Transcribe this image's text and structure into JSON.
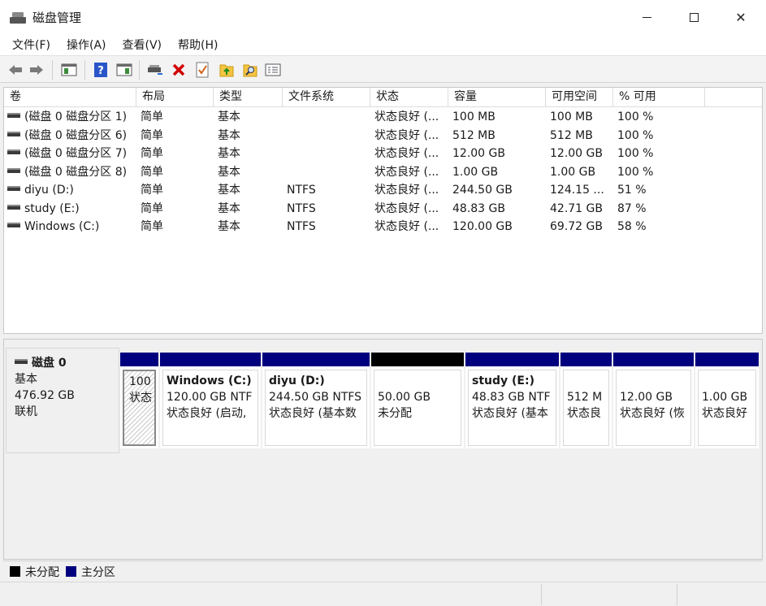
{
  "window": {
    "title": "磁盘管理"
  },
  "menu": [
    "文件(F)",
    "操作(A)",
    "查看(V)",
    "帮助(H)"
  ],
  "toolbar": {
    "icons": [
      "back-icon",
      "forward-icon",
      "properties-pane-icon",
      "help-icon",
      "action-pane-icon",
      "connect-drive-icon",
      "delete-icon",
      "check-icon",
      "import-up-icon",
      "search-icon",
      "list-icon"
    ]
  },
  "volumes": {
    "columns": [
      "卷",
      "布局",
      "类型",
      "文件系统",
      "状态",
      "容量",
      "可用空间",
      "% 可用"
    ],
    "rows": [
      [
        "(磁盘 0 磁盘分区 1)",
        "简单",
        "基本",
        "",
        "状态良好 (...",
        "100 MB",
        "100 MB",
        "100 %"
      ],
      [
        "(磁盘 0 磁盘分区 6)",
        "简单",
        "基本",
        "",
        "状态良好 (...",
        "512 MB",
        "512 MB",
        "100 %"
      ],
      [
        "(磁盘 0 磁盘分区 7)",
        "简单",
        "基本",
        "",
        "状态良好 (...",
        "12.00 GB",
        "12.00 GB",
        "100 %"
      ],
      [
        "(磁盘 0 磁盘分区 8)",
        "简单",
        "基本",
        "",
        "状态良好 (...",
        "1.00 GB",
        "1.00 GB",
        "100 %"
      ],
      [
        "diyu (D:)",
        "简单",
        "基本",
        "NTFS",
        "状态良好 (...",
        "244.50 GB",
        "124.15 ...",
        "51 %"
      ],
      [
        "study (E:)",
        "简单",
        "基本",
        "NTFS",
        "状态良好 (...",
        "48.83 GB",
        "42.71 GB",
        "87 %"
      ],
      [
        "Windows (C:)",
        "简单",
        "基本",
        "NTFS",
        "状态良好 (...",
        "120.00 GB",
        "69.72 GB",
        "58 %"
      ]
    ]
  },
  "disk": {
    "name": "磁盘 0",
    "type": "基本",
    "size": "476.92 GB",
    "status": "联机",
    "partitions": [
      {
        "title": "",
        "line1": "100",
        "line2": "状态",
        "kind": "primary"
      },
      {
        "title": "Windows  (C:)",
        "line1": "120.00 GB NTF",
        "line2": "状态良好 (启动,",
        "kind": "primary"
      },
      {
        "title": "diyu  (D:)",
        "line1": "244.50 GB NTFS",
        "line2": "状态良好 (基本数",
        "kind": "primary"
      },
      {
        "title": "",
        "line1": "50.00 GB",
        "line2": "未分配",
        "kind": "unallocated"
      },
      {
        "title": "study  (E:)",
        "line1": "48.83 GB NTF",
        "line2": "状态良好 (基本",
        "kind": "primary"
      },
      {
        "title": "",
        "line1": "512 M",
        "line2": "状态良",
        "kind": "primary"
      },
      {
        "title": "",
        "line1": "12.00 GB",
        "line2": "状态良好 (恢",
        "kind": "primary"
      },
      {
        "title": "",
        "line1": "1.00 GB",
        "line2": "状态良好",
        "kind": "primary"
      }
    ]
  },
  "legend": [
    {
      "label": "未分配",
      "color": "#000000"
    },
    {
      "label": "主分区",
      "color": "#00007f"
    }
  ]
}
